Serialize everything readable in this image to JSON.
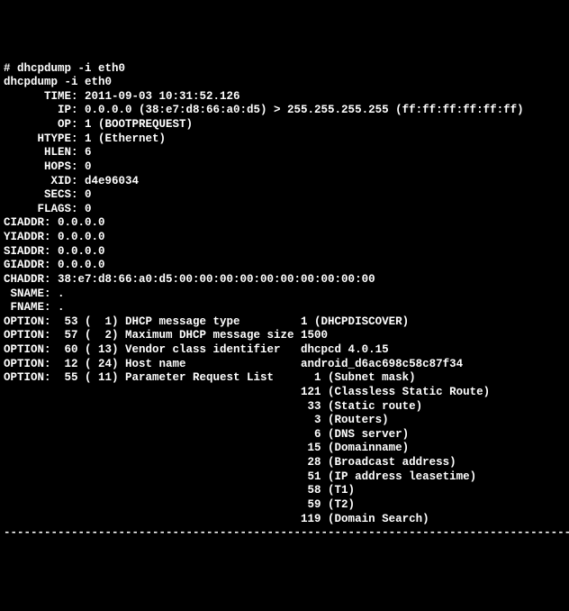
{
  "prompt": "# dhcpdump -i eth0",
  "echo": "dhcpdump -i eth0",
  "header": [
    {
      "label": "TIME",
      "pad": 6,
      "value": "2011-09-03 10:31:52.126"
    },
    {
      "label": "IP",
      "pad": 8,
      "value": "0.0.0.0 (38:e7:d8:66:a0:d5) > 255.255.255.255 (ff:ff:ff:ff:ff:ff)"
    },
    {
      "label": "OP",
      "pad": 8,
      "value": "1 (BOOTPREQUEST)"
    },
    {
      "label": "HTYPE",
      "pad": 5,
      "value": "1 (Ethernet)"
    },
    {
      "label": "HLEN",
      "pad": 6,
      "value": "6"
    },
    {
      "label": "HOPS",
      "pad": 6,
      "value": "0"
    },
    {
      "label": "XID",
      "pad": 7,
      "value": "d4e96034"
    },
    {
      "label": "SECS",
      "pad": 6,
      "value": "0"
    },
    {
      "label": "FLAGS",
      "pad": 5,
      "value": "0"
    },
    {
      "label": "CIADDR",
      "pad": 0,
      "value": "0.0.0.0"
    },
    {
      "label": "YIADDR",
      "pad": 0,
      "value": "0.0.0.0"
    },
    {
      "label": "SIADDR",
      "pad": 0,
      "value": "0.0.0.0"
    },
    {
      "label": "GIADDR",
      "pad": 0,
      "value": "0.0.0.0"
    },
    {
      "label": "CHADDR",
      "pad": 0,
      "value": "38:e7:d8:66:a0:d5:00:00:00:00:00:00:00:00:00:00"
    },
    {
      "label": "SNAME",
      "pad": 1,
      "value": "."
    },
    {
      "label": "FNAME",
      "pad": 1,
      "value": "."
    }
  ],
  "options_label": "OPTION",
  "options": [
    {
      "code": "53",
      "len": "1",
      "name": "DHCP message type",
      "value": "1 (DHCPDISCOVER)"
    },
    {
      "code": "57",
      "len": "2",
      "name": "Maximum DHCP message size",
      "value": "1500"
    },
    {
      "code": "60",
      "len": "13",
      "name": "Vendor class identifier",
      "value": "dhcpcd 4.0.15"
    },
    {
      "code": "12",
      "len": "24",
      "name": "Host name",
      "value": "android_d6ac698c58c87f34"
    },
    {
      "code": "55",
      "len": "11",
      "name": "Parameter Request List",
      "value": ""
    }
  ],
  "param_request_list": [
    {
      "num": "1",
      "desc": "Subnet mask"
    },
    {
      "num": "121",
      "desc": "Classless Static Route"
    },
    {
      "num": "33",
      "desc": "Static route"
    },
    {
      "num": "3",
      "desc": "Routers"
    },
    {
      "num": "6",
      "desc": "DNS server"
    },
    {
      "num": "15",
      "desc": "Domainname"
    },
    {
      "num": "28",
      "desc": "Broadcast address"
    },
    {
      "num": "51",
      "desc": "IP address leasetime"
    },
    {
      "num": "58",
      "desc": "T1"
    },
    {
      "num": "59",
      "desc": "T2"
    },
    {
      "num": "119",
      "desc": "Domain Search"
    }
  ]
}
